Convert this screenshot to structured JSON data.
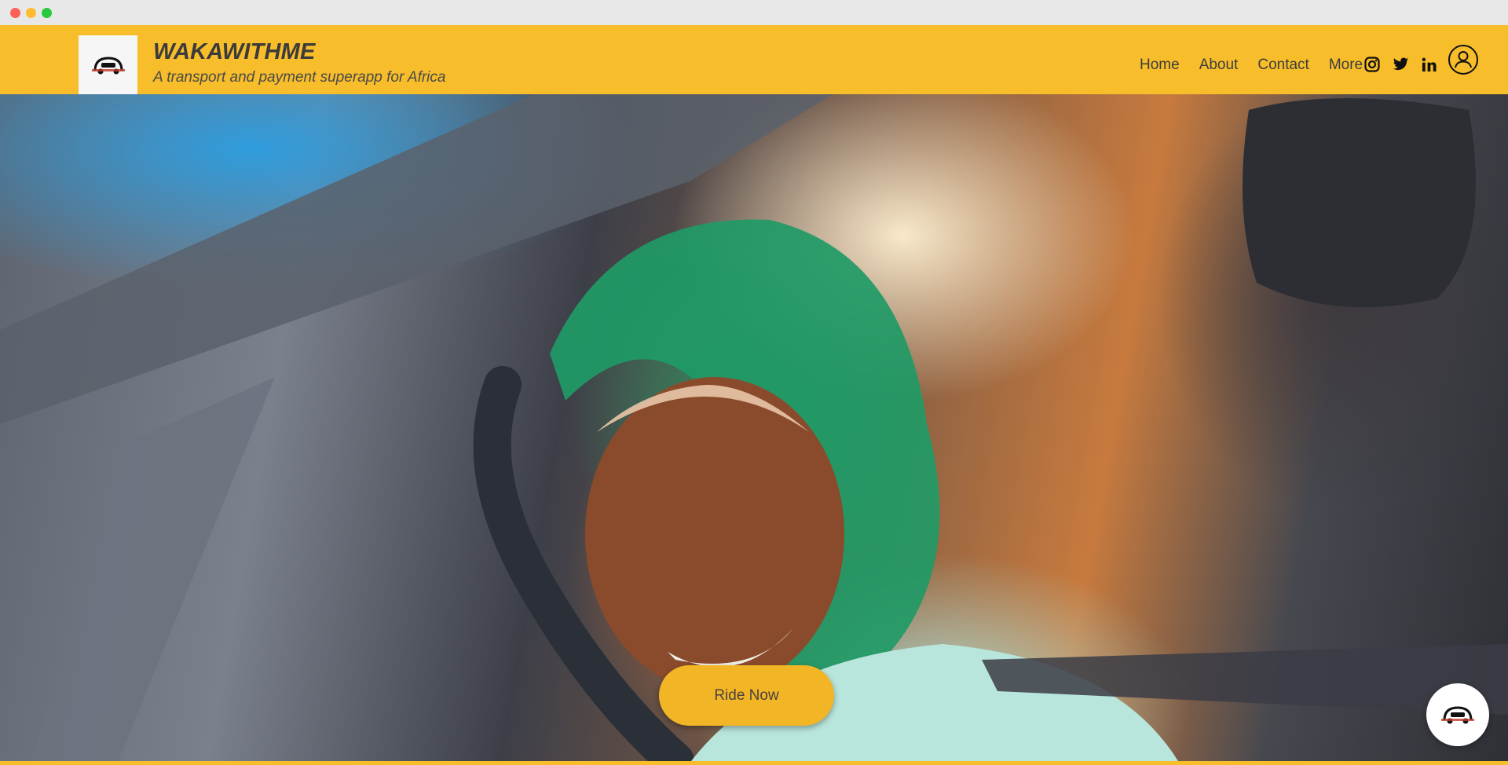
{
  "window": {
    "controls": [
      "close",
      "minimize",
      "maximize"
    ]
  },
  "header": {
    "brand": "WAKAWITHME",
    "tagline": "A transport and payment superapp for Africa",
    "logo_icon": "car-logo-icon",
    "background_color": "#f7bd2a"
  },
  "nav": {
    "items": [
      {
        "label": "Home"
      },
      {
        "label": "About"
      },
      {
        "label": "Contact"
      },
      {
        "label": "More"
      }
    ]
  },
  "social": {
    "icons": [
      "instagram-icon",
      "twitter-icon",
      "linkedin-icon"
    ]
  },
  "account": {
    "icon": "user-account-icon"
  },
  "hero": {
    "image_subject": "woman in green headscarf smiling in driver seat of car",
    "cta_label": "Ride Now"
  },
  "chat_widget": {
    "icon": "car-logo-icon"
  }
}
